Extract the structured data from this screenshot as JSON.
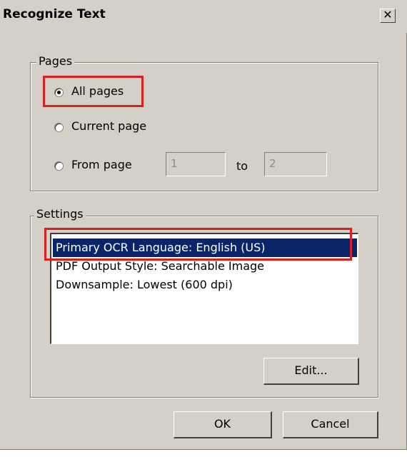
{
  "window": {
    "title": "Recognize Text",
    "close_label": "✕"
  },
  "pages": {
    "legend": "Pages",
    "options": [
      {
        "label": "All pages",
        "selected": true
      },
      {
        "label": "Current page",
        "selected": false
      },
      {
        "label": "From page",
        "selected": false
      }
    ],
    "from_value": "1",
    "to_label": "to",
    "to_value": "2"
  },
  "settings": {
    "legend": "Settings",
    "items": [
      {
        "label": "Primary OCR Language: English (US)",
        "selected": true
      },
      {
        "label": "PDF Output Style: Searchable Image",
        "selected": false
      },
      {
        "label": "Downsample: Lowest (600 dpi)",
        "selected": false
      }
    ],
    "edit_label": "Edit..."
  },
  "buttons": {
    "ok_label": "OK",
    "cancel_label": "Cancel"
  },
  "colors": {
    "dialog_bg": "#d4d0c8",
    "selection_bg": "#0a246a",
    "highlight_border": "#d82020"
  }
}
